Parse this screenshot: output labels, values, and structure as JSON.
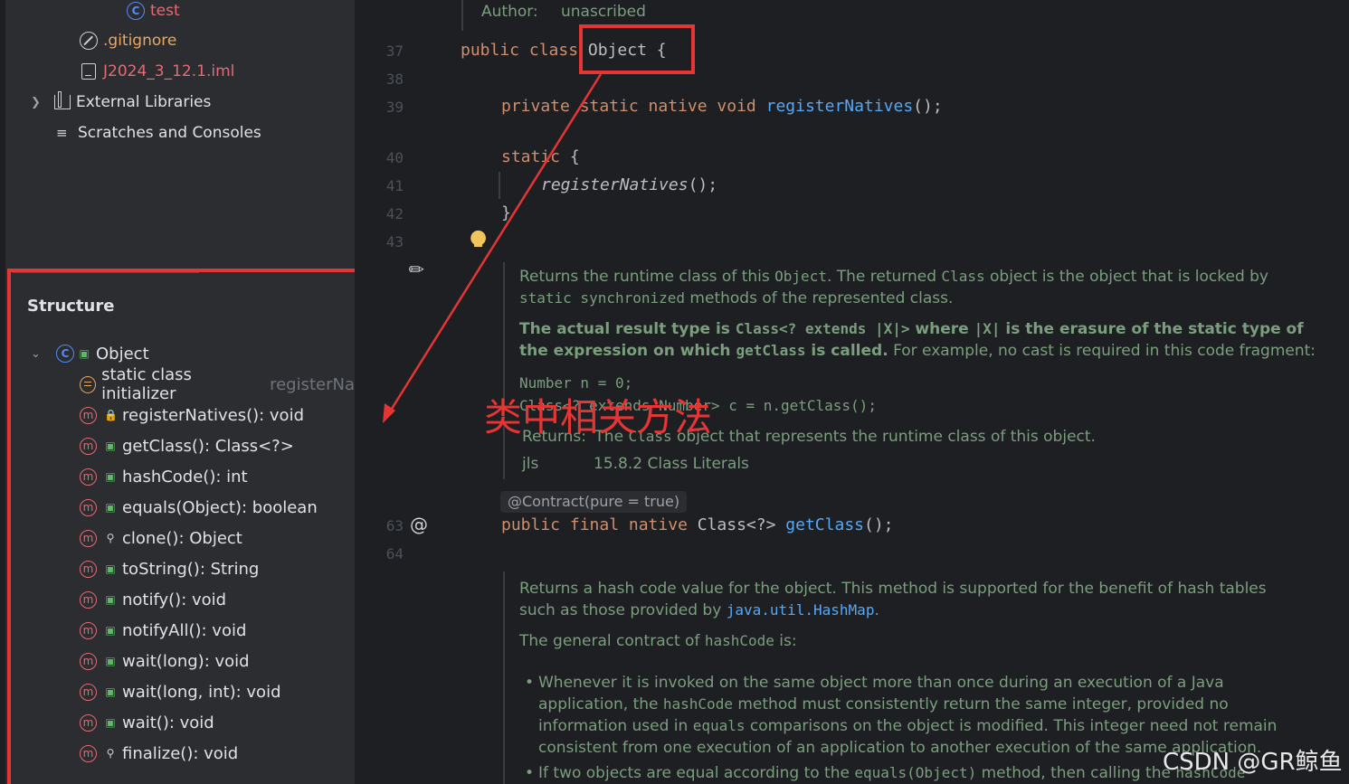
{
  "project_tree": {
    "items": [
      {
        "label": "test",
        "icon": "class-icon",
        "color": "#548af7"
      },
      {
        "label": ".gitignore",
        "icon": "ignored-file-icon",
        "color": "#e8a863"
      },
      {
        "label": "J2024_3_12.1.iml",
        "icon": "module-file-icon",
        "color": "#e06c75"
      },
      {
        "label": "External Libraries",
        "icon": "library-icon",
        "color": "#dfe1e5"
      },
      {
        "label": "Scratches and Consoles",
        "icon": "scratches-icon",
        "color": "#dfe1e5"
      }
    ]
  },
  "structure": {
    "title": "Structure",
    "root": "Object",
    "items": [
      {
        "label": "static class initializer",
        "suffix": "registerNa",
        "icon": "initializer-icon",
        "visibility": "none"
      },
      {
        "label": "registerNatives(): void",
        "icon": "method-icon",
        "visibility": "private"
      },
      {
        "label": "getClass(): Class<?>",
        "icon": "method-icon",
        "visibility": "public"
      },
      {
        "label": "hashCode(): int",
        "icon": "method-icon",
        "visibility": "public"
      },
      {
        "label": "equals(Object): boolean",
        "icon": "method-icon",
        "visibility": "public"
      },
      {
        "label": "clone(): Object",
        "icon": "method-icon",
        "visibility": "protected"
      },
      {
        "label": "toString(): String",
        "icon": "method-icon",
        "visibility": "public"
      },
      {
        "label": "notify(): void",
        "icon": "method-icon",
        "visibility": "public"
      },
      {
        "label": "notifyAll(): void",
        "icon": "method-icon",
        "visibility": "public"
      },
      {
        "label": "wait(long): void",
        "icon": "method-icon",
        "visibility": "public"
      },
      {
        "label": "wait(long, int): void",
        "icon": "method-icon",
        "visibility": "public"
      },
      {
        "label": "wait(): void",
        "icon": "method-icon",
        "visibility": "public"
      },
      {
        "label": "finalize(): void",
        "icon": "method-icon",
        "visibility": "protected"
      }
    ]
  },
  "editor": {
    "author_label": "Author:",
    "author_value": "unascribed",
    "line_numbers": [
      "37",
      "38",
      "39",
      "40",
      "41",
      "42",
      "43",
      "63",
      "64"
    ],
    "code": {
      "l37_kw": "public class",
      "l37_name": "Object {",
      "l39_kw": "private static native void",
      "l39_fn": "registerNatives",
      "l39_end": "();",
      "l40_kw": "static",
      "l40_end": "{",
      "l41": "registerNatives",
      "l41_end": "();",
      "l42": "}",
      "l63_kw": "public final native",
      "l63_type": "Class<?>",
      "l63_fn": "getClass",
      "l63_end": "();"
    },
    "doc_getclass": {
      "p1a": "Returns the runtime class of this ",
      "p1b": "Object",
      "p1c": ". The returned ",
      "p1d": "Class",
      "p1e": " object is the object that is locked by",
      "p2a": "static synchronized",
      "p2b": " methods of the represented class.",
      "p3a": "The actual result type is ",
      "p3b": "Class<? extends |X|>",
      "p3c": " where ",
      "p3d": "|X|",
      "p3e": " is the erasure of the static type of",
      "p4a": "the expression on which ",
      "p4b": "getClass",
      "p4c": " is called.",
      "p4d": " For example, no cast is required in this code fragment:",
      "code1": "Number n = 0;",
      "code2": "Class<? extends Number> c = n.getClass();",
      "returns_label": "Returns:",
      "returns_a": "The ",
      "returns_b": "Class",
      "returns_c": " object that represents the runtime class of this object.",
      "jls_label": "jls",
      "jls_value": "15.8.2 Class Literals"
    },
    "contract": "@Contract(pure = true)",
    "doc_hashcode": {
      "p1": "Returns a hash code value for the object. This method is supported for the benefit of hash tables",
      "p2a": "such as those provided by ",
      "p2b": "java.util.HashMap",
      "p2c": ".",
      "p3a": "The general contract of ",
      "p3b": "hashCode",
      "p3c": " is:",
      "b1_1": "Whenever it is invoked on the same object more than once during an execution of a Java",
      "b1_2a": "application, the ",
      "b1_2b": "hashCode",
      "b1_2c": " method must consistently return the same integer, provided no",
      "b1_3a": "information used in ",
      "b1_3b": "equals",
      "b1_3c": " comparisons on the object is modified. This integer need not remain",
      "b1_4": "consistent from one execution of an application to another execution of the same application.",
      "b2a": "If two objects are equal according to the ",
      "b2b": "equals(Object)",
      "b2c": " method, then calling the ",
      "b2d": "hashCode"
    }
  },
  "annotation": {
    "text": "类中相关方法",
    "color": "#e53535"
  },
  "watermark": "CSDN @GR鲸鱼"
}
